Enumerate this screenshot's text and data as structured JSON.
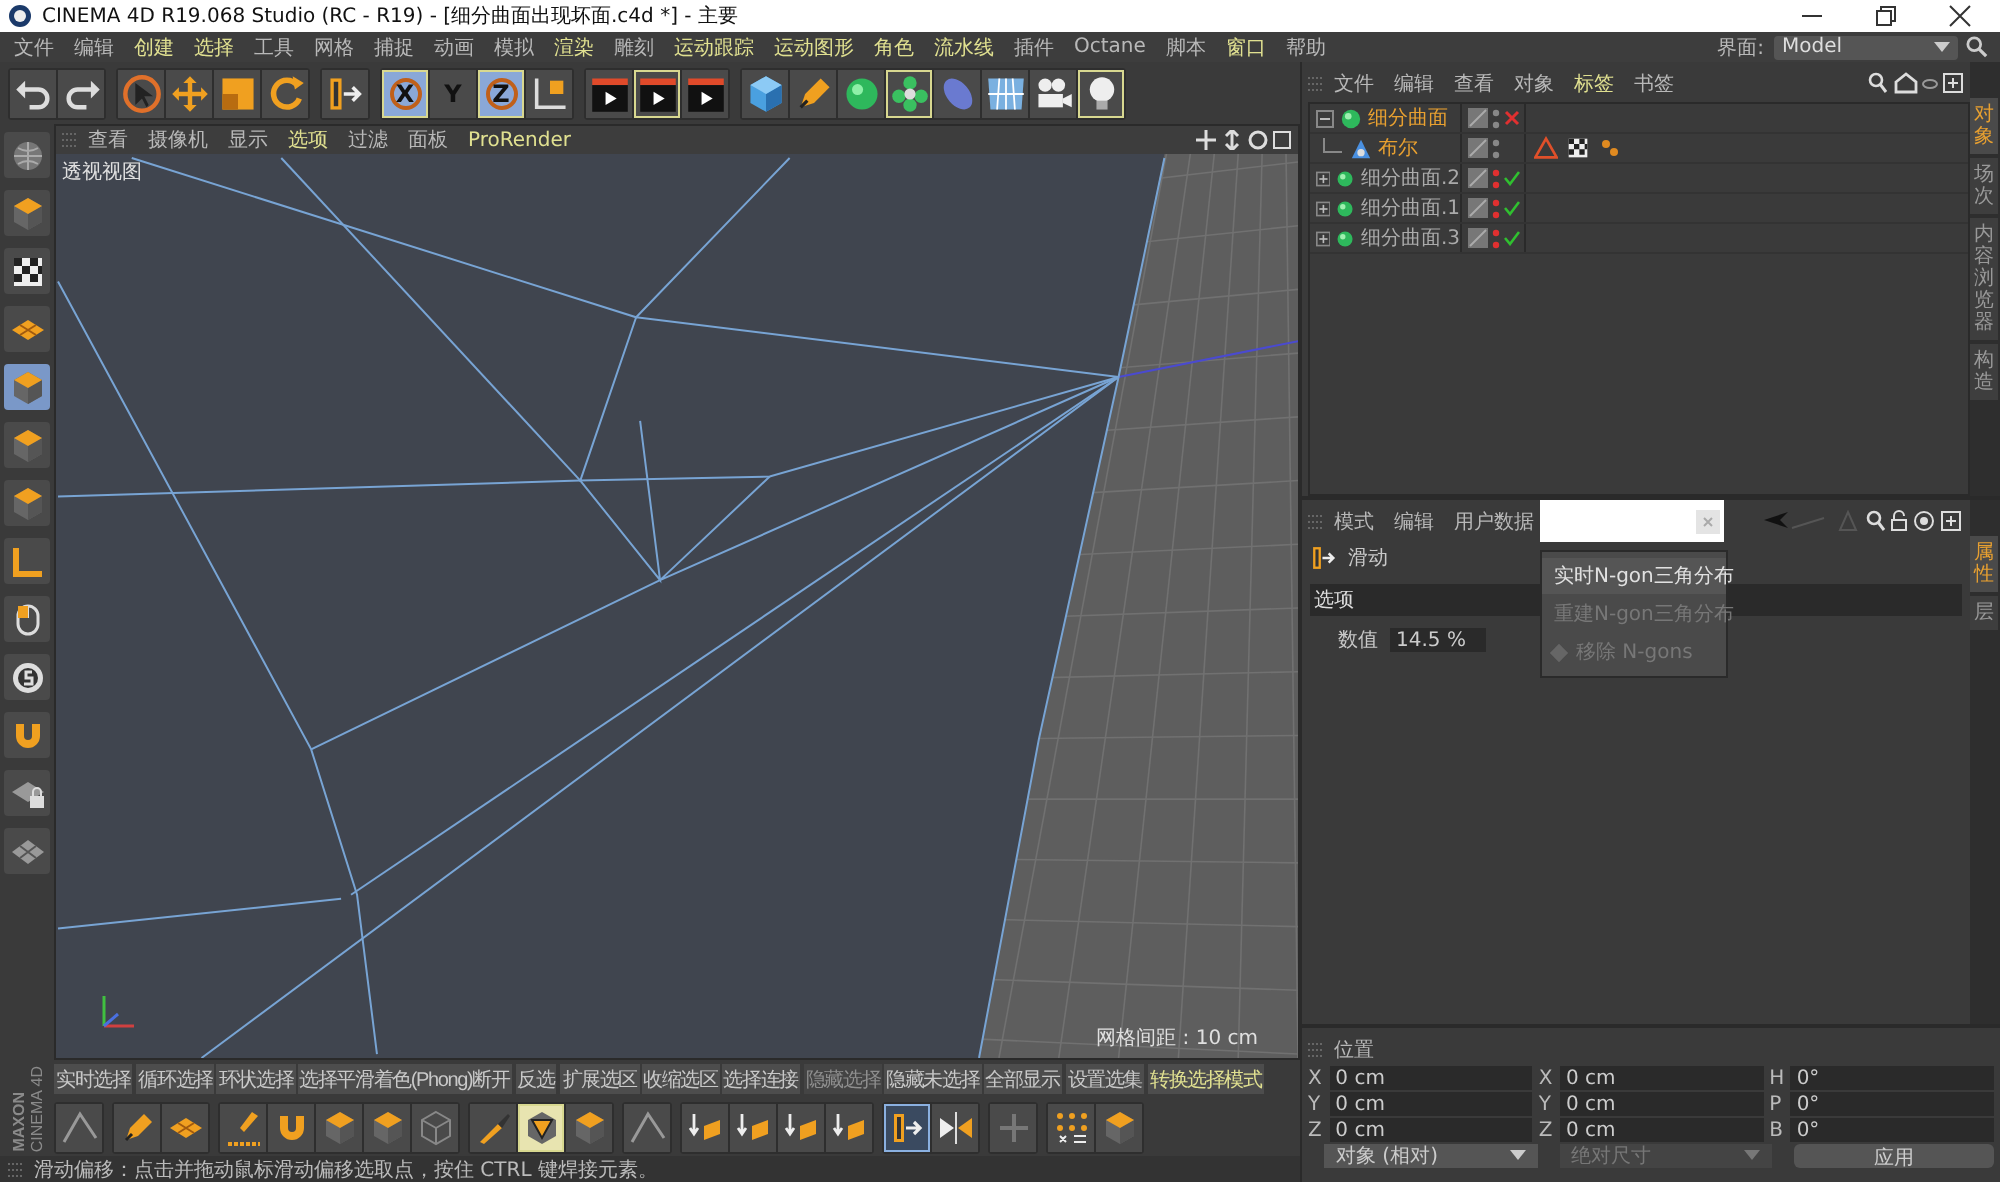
{
  "window": {
    "title": "CINEMA 4D R19.068 Studio (RC - R19) - [细分曲面出现坏面.c4d *] - 主要"
  },
  "menu_bar": [
    {
      "label": "文件",
      "accent": false
    },
    {
      "label": "编辑",
      "accent": false
    },
    {
      "label": "创建",
      "accent": true
    },
    {
      "label": "选择",
      "accent": true
    },
    {
      "label": "工具",
      "accent": false
    },
    {
      "label": "网格",
      "accent": false
    },
    {
      "label": "捕捉",
      "accent": false
    },
    {
      "label": "动画",
      "accent": false
    },
    {
      "label": "模拟",
      "accent": false
    },
    {
      "label": "渲染",
      "accent": true
    },
    {
      "label": "雕刻",
      "accent": false
    },
    {
      "label": "运动跟踪",
      "accent": true
    },
    {
      "label": "运动图形",
      "accent": true
    },
    {
      "label": "角色",
      "accent": true
    },
    {
      "label": "流水线",
      "accent": true
    },
    {
      "label": "插件",
      "accent": false
    },
    {
      "label": "Octane",
      "accent": false
    },
    {
      "label": "脚本",
      "accent": false
    },
    {
      "label": "窗口",
      "accent": true
    },
    {
      "label": "帮助",
      "accent": false
    }
  ],
  "interface": {
    "label": "界面:",
    "value": "Model"
  },
  "toolbar": [
    [
      {
        "kind": "undo",
        "selected": false
      },
      {
        "kind": "redo",
        "selected": false
      }
    ],
    [
      {
        "kind": "cursor",
        "selected": false
      },
      {
        "kind": "move",
        "selected": false
      },
      {
        "kind": "scale",
        "selected": false
      },
      {
        "kind": "rotate",
        "selected": false
      }
    ],
    [
      {
        "kind": "slide",
        "selected": false
      }
    ],
    [
      {
        "kind": "axis-letter",
        "label": "X",
        "selected": true
      },
      {
        "kind": "axis-letter",
        "label": "Y",
        "selected": false
      },
      {
        "kind": "axis-letter",
        "label": "Z",
        "selected": true
      },
      {
        "kind": "axis",
        "selected": false
      }
    ],
    [
      {
        "kind": "clapper",
        "selected": false
      },
      {
        "kind": "clapper",
        "selected": true
      },
      {
        "kind": "clapper",
        "selected": false
      }
    ],
    [
      {
        "kind": "cube",
        "selected": false
      },
      {
        "kind": "pen",
        "selected": false
      },
      {
        "kind": "sphere",
        "selected": false
      },
      {
        "kind": "flower",
        "selected": true
      },
      {
        "kind": "capsule",
        "selected": false
      },
      {
        "kind": "floor",
        "selected": false
      },
      {
        "kind": "camera",
        "selected": false
      },
      {
        "kind": "bulb",
        "selected": true
      }
    ]
  ],
  "left_toolbar": [
    {
      "kind": "sphere-grid",
      "selected": false
    },
    {
      "kind": "box",
      "selected": false
    },
    {
      "kind": "checker",
      "selected": false
    },
    {
      "kind": "plane",
      "selected": false
    },
    {
      "kind": "box",
      "selected": true
    },
    {
      "kind": "box",
      "selected": false
    },
    {
      "kind": "box",
      "selected": false
    },
    {
      "kind": "lshape",
      "selected": false
    },
    {
      "kind": "mouse",
      "selected": false
    },
    {
      "kind": "coin",
      "selected": false
    },
    {
      "kind": "magnet",
      "selected": false
    },
    {
      "kind": "lock-grid",
      "selected": false
    },
    {
      "kind": "grid",
      "selected": false
    }
  ],
  "viewport": {
    "menu": [
      {
        "label": "查看",
        "accent": false
      },
      {
        "label": "摄像机",
        "accent": false
      },
      {
        "label": "显示",
        "accent": false
      },
      {
        "label": "选项",
        "accent": true
      },
      {
        "label": "过滤",
        "accent": false
      },
      {
        "label": "面板",
        "accent": false
      },
      {
        "label": "ProRender",
        "accent": true
      }
    ],
    "title": "透视视图",
    "grid_spacing": "网格间距 : 10 cm"
  },
  "selection_bar": [
    [
      {
        "label": "实时选择",
        "disabled": false,
        "accent": false
      }
    ],
    [
      {
        "label": "循环选择",
        "disabled": false,
        "accent": false
      },
      {
        "label": "环状选择",
        "disabled": false,
        "accent": false
      },
      {
        "label": "选择平滑着色(Phong)断开",
        "disabled": false,
        "accent": false
      }
    ],
    [
      {
        "label": "反选",
        "disabled": false,
        "accent": false
      }
    ],
    [
      {
        "label": "扩展选区",
        "disabled": false,
        "accent": false
      },
      {
        "label": "收缩选区",
        "disabled": false,
        "accent": false
      },
      {
        "label": "选择连接",
        "disabled": false,
        "accent": false
      }
    ],
    [
      {
        "label": "隐藏选择",
        "disabled": true,
        "accent": false
      },
      {
        "label": "隐藏未选择",
        "disabled": false,
        "accent": false
      },
      {
        "label": "全部显示",
        "disabled": false,
        "accent": false
      }
    ],
    [
      {
        "label": "设置选集",
        "disabled": false,
        "accent": false
      }
    ],
    [
      {
        "label": "转换选择模式",
        "disabled": false,
        "accent": true
      }
    ]
  ],
  "tool_bar": [
    [
      {
        "kind": "line",
        "selected": false
      }
    ],
    [
      {
        "kind": "pen",
        "selected": false
      },
      {
        "kind": "plane",
        "selected": false
      }
    ],
    [
      {
        "kind": "brush",
        "selected": false
      },
      {
        "kind": "magnet",
        "selected": false
      },
      {
        "kind": "box",
        "selected": false
      },
      {
        "kind": "box",
        "selected": false
      },
      {
        "kind": "wire-box",
        "selected": false
      }
    ],
    [
      {
        "kind": "knife",
        "selected": false
      },
      {
        "kind": "triangle",
        "selected": true
      },
      {
        "kind": "box",
        "selected": false
      }
    ],
    [
      {
        "kind": "line",
        "selected": false
      }
    ],
    [
      {
        "kind": "arrows",
        "selected": false
      },
      {
        "kind": "arrows",
        "selected": false
      },
      {
        "kind": "arrows",
        "selected": false
      },
      {
        "kind": "arrows",
        "selected": false
      }
    ],
    [
      {
        "kind": "slide",
        "selected": true
      },
      {
        "kind": "mirror",
        "selected": false
      }
    ],
    [
      {
        "kind": "plus",
        "selected": false
      }
    ],
    [
      {
        "kind": "dots",
        "selected": false
      },
      {
        "kind": "box",
        "selected": false
      }
    ]
  ],
  "status_bar": "滑动偏移：点击并拖动鼠标滑动偏移选取点，按住 CTRL 键焊接元素。",
  "logo": {
    "brand": "MAXON",
    "product": "CINEMA 4D"
  },
  "object_manager": {
    "menu": [
      {
        "label": "文件",
        "accent": false
      },
      {
        "label": "编辑",
        "accent": false
      },
      {
        "label": "查看",
        "accent": false
      },
      {
        "label": "对象",
        "accent": false
      },
      {
        "label": "标签",
        "accent": true
      },
      {
        "label": "书签",
        "accent": false
      }
    ],
    "objects": [
      {
        "name": "细分曲面",
        "selected": true,
        "enabled": false,
        "children": [
          {
            "name": "布尔",
            "selected": true,
            "tags": [
              {
                "kind": "warning"
              },
              {
                "kind": "checker"
              },
              {
                "kind": "tag-dots"
              }
            ]
          }
        ]
      },
      {
        "name": "细分曲面.2",
        "selected": false,
        "enabled": true
      },
      {
        "name": "细分曲面.1",
        "selected": false,
        "enabled": true
      },
      {
        "name": "细分曲面.3",
        "selected": false,
        "enabled": true
      }
    ],
    "side_tabs": [
      {
        "label": "对象",
        "selected": true
      },
      {
        "label": "场次",
        "selected": false
      },
      {
        "label": "内容浏览器",
        "selected": false
      },
      {
        "label": "构造",
        "selected": false
      }
    ]
  },
  "attributes": {
    "menu": [
      {
        "label": "模式",
        "accent": false
      },
      {
        "label": "编辑",
        "accent": false
      },
      {
        "label": "用户数据",
        "accent": false
      }
    ],
    "popup": [
      {
        "label": "实时N-gon三角分布",
        "disabled": false
      },
      {
        "label": "重建N-gon三角分布",
        "disabled": true
      },
      {
        "label": "移除 N-gons",
        "disabled": true
      }
    ],
    "tool": "滑动",
    "section": "选项",
    "fields": [
      {
        "label": "数值",
        "value": "14.5 %"
      }
    ],
    "side_tabs": [
      {
        "label": "属性",
        "selected": true
      },
      {
        "label": "层",
        "selected": false
      }
    ]
  },
  "coordinates": {
    "title": "位置",
    "rows": [
      [
        {
          "label": "X",
          "value": "0 cm"
        },
        {
          "label": "X",
          "value": "0 cm"
        },
        {
          "label": "H",
          "value": "0°"
        }
      ],
      [
        {
          "label": "Y",
          "value": "0 cm"
        },
        {
          "label": "Y",
          "value": "0 cm"
        },
        {
          "label": "P",
          "value": "0°"
        }
      ],
      [
        {
          "label": "Z",
          "value": "0 cm"
        },
        {
          "label": "Z",
          "value": "0 cm"
        },
        {
          "label": "B",
          "value": "0°"
        }
      ]
    ],
    "mode": "对象 (相对)",
    "size_mode": {
      "label": "绝对尺寸",
      "disabled": true
    },
    "apply": "应用"
  }
}
